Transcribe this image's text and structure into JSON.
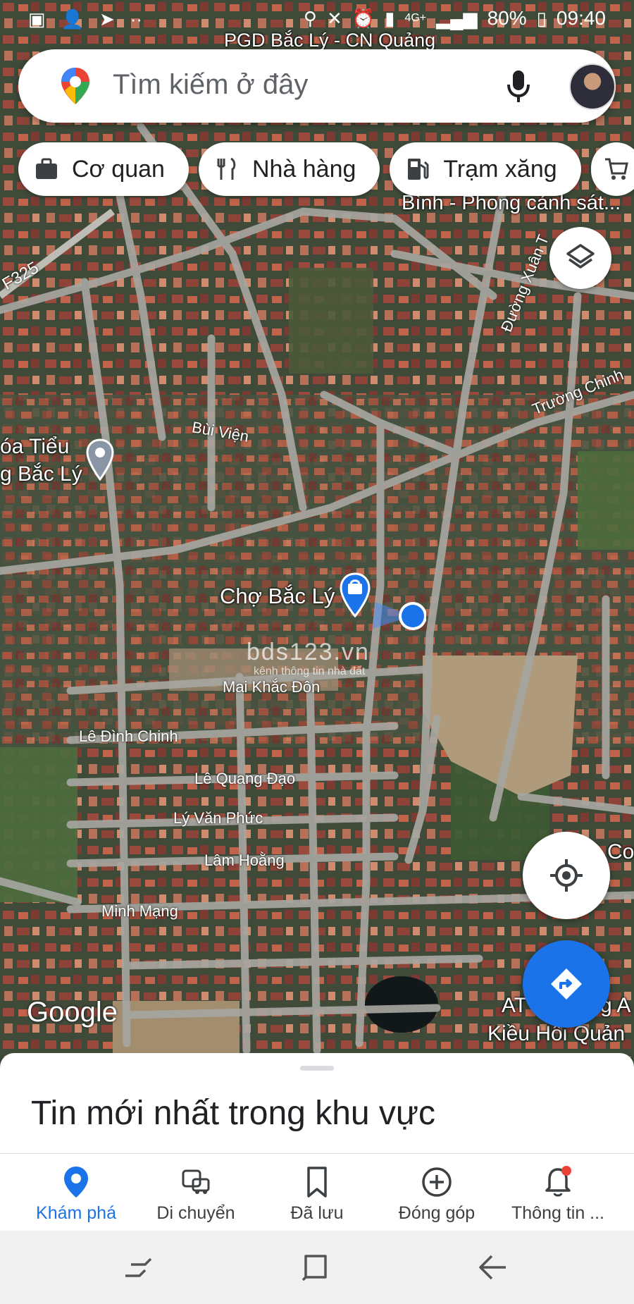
{
  "status_bar": {
    "battery": "80%",
    "time": "09:40",
    "network": "4G+"
  },
  "search": {
    "placeholder": "Tìm kiếm ở đây"
  },
  "chips": [
    {
      "label": "Cơ quan",
      "icon": "briefcase-icon"
    },
    {
      "label": "Nhà hàng",
      "icon": "restaurant-icon"
    },
    {
      "label": "Trạm xăng",
      "icon": "gas-station-icon"
    },
    {
      "label": "",
      "icon": "cart-icon"
    }
  ],
  "map": {
    "labels": {
      "pgd": "PGD Bắc Lý - CN Quảng",
      "police": "Bình - Phong cảnh sát...",
      "road_f325": "F325",
      "duong_xuan": "Đường Xuân T",
      "truong_chinh": "Trường Chinh",
      "bui_vien": "Bùi Viện",
      "school_1": "óa Tiểu",
      "school_2": "g Bắc Lý",
      "cho_bac_ly": "Chợ Bắc Lý",
      "mai_khac_don": "Mai Khắc Đôn",
      "le_dinh_chinh": "Lê Đình Chinh",
      "le_quang_dao": "Lê Quang Đạo",
      "ly_van_phuc": "Lý Văn Phức",
      "lam_hoang": "Lâm Hoằng",
      "minh_mang": "Minh Mạng",
      "coffee": "Coff",
      "atm_1": "AT",
      "atm_1b": "g A",
      "atm_2": "Kiều Hối Quản",
      "watermark": "bds123.vn",
      "watermark_sub": "kênh thông tin nhà đất",
      "google": "Google"
    }
  },
  "sheet": {
    "title": "Tin mới nhất trong khu vực"
  },
  "bottom_nav": [
    {
      "label": "Khám phá",
      "icon": "explore-pin-icon",
      "active": true
    },
    {
      "label": "Di chuyển",
      "icon": "commute-icon",
      "active": false
    },
    {
      "label": "Đã lưu",
      "icon": "bookmark-icon",
      "active": false
    },
    {
      "label": "Đóng góp",
      "icon": "add-circle-icon",
      "active": false
    },
    {
      "label": "Thông tin ...",
      "icon": "bell-icon",
      "active": false
    }
  ],
  "colors": {
    "accent": "#1a73e8",
    "map_road": "#a6a6a0",
    "notification_dot": "#ea4335"
  }
}
